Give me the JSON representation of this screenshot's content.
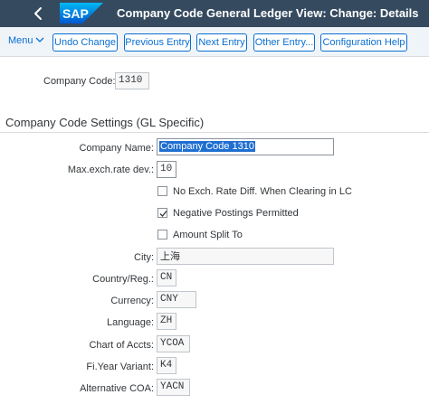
{
  "shell": {
    "title": "Company Code General Ledger View: Change: Details",
    "logo_text": "SAP"
  },
  "toolbar": {
    "menu_label": "Menu",
    "buttons": [
      "Undo Change",
      "Previous Entry",
      "Next Entry",
      "Other Entry...",
      "Configuration Help"
    ]
  },
  "header": {
    "company_code_label": "Company Code:",
    "company_code_value": "1310"
  },
  "section": {
    "title": "Company Code Settings (GL Specific)"
  },
  "fields": {
    "company_name": {
      "label": "Company Name:",
      "value": "Company Code 1310"
    },
    "max_exch_rate": {
      "label": "Max.exch.rate dev.:",
      "value": "10"
    },
    "city": {
      "label": "City:",
      "value": "上海"
    },
    "country": {
      "label": "Country/Reg.:",
      "value": "CN"
    },
    "currency": {
      "label": "Currency:",
      "value": "CNY"
    },
    "language": {
      "label": "Language:",
      "value": "ZH"
    },
    "chart_of_accts": {
      "label": "Chart of Accts:",
      "value": "YCOA"
    },
    "fi_year_variant": {
      "label": "Fi.Year Variant:",
      "value": "K4"
    },
    "alt_coa": {
      "label": "Alternative COA:",
      "value": "YACN"
    }
  },
  "checkboxes": [
    {
      "label": "No Exch. Rate Diff. When Clearing in LC",
      "checked": false
    },
    {
      "label": "Negative Postings Permitted",
      "checked": true
    },
    {
      "label": "Amount Split To",
      "checked": false
    }
  ],
  "colors": {
    "shell_bg": "#354a5f",
    "accent": "#0a6ed1",
    "toolbar_bg": "#eff4f9",
    "selection": "#1f6fd1"
  },
  "icons": {
    "back": "back-chevron-icon",
    "menu_chevron": "chevron-down-icon",
    "check": "checkmark-icon"
  }
}
